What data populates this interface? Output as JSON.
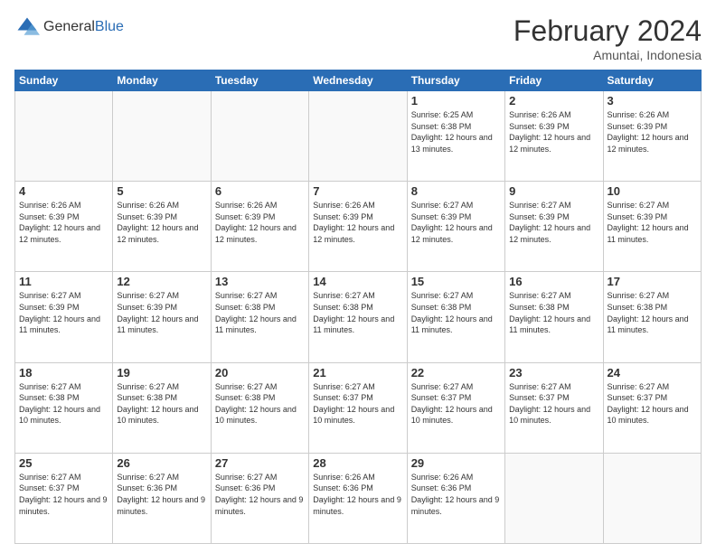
{
  "logo": {
    "general": "General",
    "blue": "Blue"
  },
  "header": {
    "month": "February 2024",
    "location": "Amuntai, Indonesia"
  },
  "weekdays": [
    "Sunday",
    "Monday",
    "Tuesday",
    "Wednesday",
    "Thursday",
    "Friday",
    "Saturday"
  ],
  "weeks": [
    [
      {
        "day": "",
        "empty": true
      },
      {
        "day": "",
        "empty": true
      },
      {
        "day": "",
        "empty": true
      },
      {
        "day": "",
        "empty": true
      },
      {
        "day": "1",
        "sunrise": "6:25 AM",
        "sunset": "6:38 PM",
        "daylight": "12 hours and 13 minutes."
      },
      {
        "day": "2",
        "sunrise": "6:26 AM",
        "sunset": "6:39 PM",
        "daylight": "12 hours and 12 minutes."
      },
      {
        "day": "3",
        "sunrise": "6:26 AM",
        "sunset": "6:39 PM",
        "daylight": "12 hours and 12 minutes."
      }
    ],
    [
      {
        "day": "4",
        "sunrise": "6:26 AM",
        "sunset": "6:39 PM",
        "daylight": "12 hours and 12 minutes."
      },
      {
        "day": "5",
        "sunrise": "6:26 AM",
        "sunset": "6:39 PM",
        "daylight": "12 hours and 12 minutes."
      },
      {
        "day": "6",
        "sunrise": "6:26 AM",
        "sunset": "6:39 PM",
        "daylight": "12 hours and 12 minutes."
      },
      {
        "day": "7",
        "sunrise": "6:26 AM",
        "sunset": "6:39 PM",
        "daylight": "12 hours and 12 minutes."
      },
      {
        "day": "8",
        "sunrise": "6:27 AM",
        "sunset": "6:39 PM",
        "daylight": "12 hours and 12 minutes."
      },
      {
        "day": "9",
        "sunrise": "6:27 AM",
        "sunset": "6:39 PM",
        "daylight": "12 hours and 12 minutes."
      },
      {
        "day": "10",
        "sunrise": "6:27 AM",
        "sunset": "6:39 PM",
        "daylight": "12 hours and 11 minutes."
      }
    ],
    [
      {
        "day": "11",
        "sunrise": "6:27 AM",
        "sunset": "6:39 PM",
        "daylight": "12 hours and 11 minutes."
      },
      {
        "day": "12",
        "sunrise": "6:27 AM",
        "sunset": "6:39 PM",
        "daylight": "12 hours and 11 minutes."
      },
      {
        "day": "13",
        "sunrise": "6:27 AM",
        "sunset": "6:38 PM",
        "daylight": "12 hours and 11 minutes."
      },
      {
        "day": "14",
        "sunrise": "6:27 AM",
        "sunset": "6:38 PM",
        "daylight": "12 hours and 11 minutes."
      },
      {
        "day": "15",
        "sunrise": "6:27 AM",
        "sunset": "6:38 PM",
        "daylight": "12 hours and 11 minutes."
      },
      {
        "day": "16",
        "sunrise": "6:27 AM",
        "sunset": "6:38 PM",
        "daylight": "12 hours and 11 minutes."
      },
      {
        "day": "17",
        "sunrise": "6:27 AM",
        "sunset": "6:38 PM",
        "daylight": "12 hours and 11 minutes."
      }
    ],
    [
      {
        "day": "18",
        "sunrise": "6:27 AM",
        "sunset": "6:38 PM",
        "daylight": "12 hours and 10 minutes."
      },
      {
        "day": "19",
        "sunrise": "6:27 AM",
        "sunset": "6:38 PM",
        "daylight": "12 hours and 10 minutes."
      },
      {
        "day": "20",
        "sunrise": "6:27 AM",
        "sunset": "6:38 PM",
        "daylight": "12 hours and 10 minutes."
      },
      {
        "day": "21",
        "sunrise": "6:27 AM",
        "sunset": "6:37 PM",
        "daylight": "12 hours and 10 minutes."
      },
      {
        "day": "22",
        "sunrise": "6:27 AM",
        "sunset": "6:37 PM",
        "daylight": "12 hours and 10 minutes."
      },
      {
        "day": "23",
        "sunrise": "6:27 AM",
        "sunset": "6:37 PM",
        "daylight": "12 hours and 10 minutes."
      },
      {
        "day": "24",
        "sunrise": "6:27 AM",
        "sunset": "6:37 PM",
        "daylight": "12 hours and 10 minutes."
      }
    ],
    [
      {
        "day": "25",
        "sunrise": "6:27 AM",
        "sunset": "6:37 PM",
        "daylight": "12 hours and 9 minutes."
      },
      {
        "day": "26",
        "sunrise": "6:27 AM",
        "sunset": "6:36 PM",
        "daylight": "12 hours and 9 minutes."
      },
      {
        "day": "27",
        "sunrise": "6:27 AM",
        "sunset": "6:36 PM",
        "daylight": "12 hours and 9 minutes."
      },
      {
        "day": "28",
        "sunrise": "6:26 AM",
        "sunset": "6:36 PM",
        "daylight": "12 hours and 9 minutes."
      },
      {
        "day": "29",
        "sunrise": "6:26 AM",
        "sunset": "6:36 PM",
        "daylight": "12 hours and 9 minutes."
      },
      {
        "day": "",
        "empty": true
      },
      {
        "day": "",
        "empty": true
      }
    ]
  ],
  "labels": {
    "sunrise": "Sunrise:",
    "sunset": "Sunset:",
    "daylight": "Daylight hours"
  }
}
